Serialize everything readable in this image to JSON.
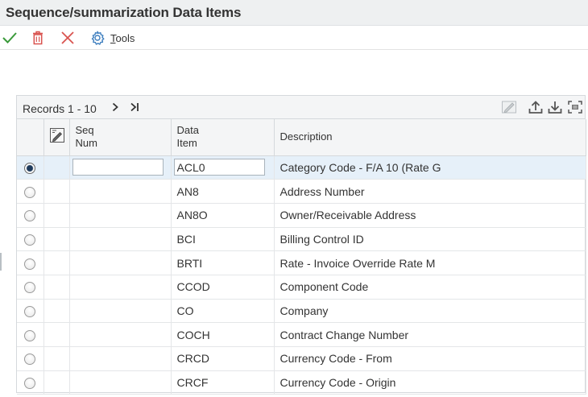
{
  "title": "Sequence/summarization Data Items",
  "toolbar": {
    "ok_icon": "check-icon",
    "delete_icon": "trash-icon",
    "cancel_icon": "close-icon",
    "tools_icon": "gear-icon",
    "tools_label": "Tools",
    "tools_label_mnemonic": "T",
    "tools_label_rest": "ools"
  },
  "grid": {
    "records_label": "Records 1 - 10",
    "columns": {
      "seq_num_line1": "Seq",
      "seq_num_line2": "Num",
      "data_item_line1": "Data",
      "data_item_line2": "Item",
      "description": "Description"
    },
    "rows": [
      {
        "data_item": "ACL0",
        "description": "Category Code - F/A 10 (Rate G",
        "selected": true,
        "seq_num": ""
      },
      {
        "data_item": "AN8",
        "description": "Address Number",
        "selected": false
      },
      {
        "data_item": "AN8O",
        "description": "Owner/Receivable Address",
        "selected": false
      },
      {
        "data_item": "BCI",
        "description": "Billing Control ID",
        "selected": false
      },
      {
        "data_item": "BRTI",
        "description": "Rate - Invoice Override Rate M",
        "selected": false
      },
      {
        "data_item": "CCOD",
        "description": "Component Code",
        "selected": false
      },
      {
        "data_item": "CO",
        "description": "Company",
        "selected": false
      },
      {
        "data_item": "COCH",
        "description": "Contract Change Number",
        "selected": false
      },
      {
        "data_item": "CRCD",
        "description": "Currency Code - From",
        "selected": false
      },
      {
        "data_item": "CRCF",
        "description": "Currency Code - Origin",
        "selected": false
      }
    ]
  },
  "colors": {
    "accept": "#3a9a3a",
    "delete": "#d9534f",
    "cancel": "#d9534f",
    "tools": "#3f7fbf",
    "selected_row": "#e6f0f9"
  }
}
